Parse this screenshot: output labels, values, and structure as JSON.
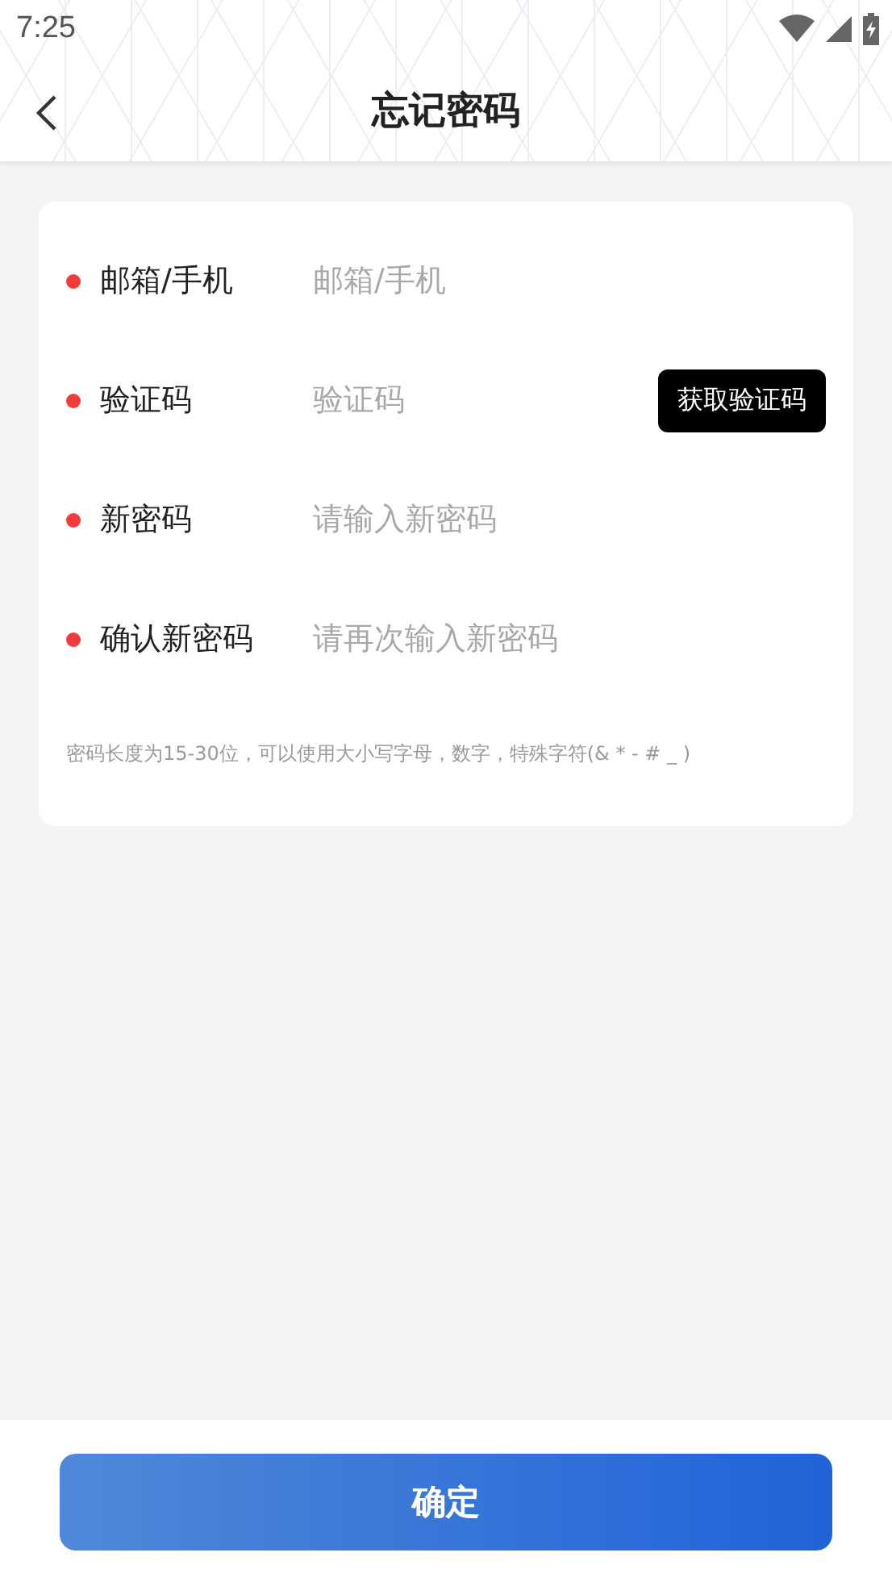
{
  "status_bar": {
    "time": "7:25"
  },
  "header": {
    "title": "忘记密码"
  },
  "fields": [
    {
      "kind": "text",
      "label": "邮箱/手机",
      "placeholder": "邮箱/手机",
      "required": true
    },
    {
      "kind": "code",
      "label": "验证码",
      "placeholder": "验证码",
      "required": true,
      "button": "获取验证码"
    },
    {
      "kind": "text",
      "label": "新密码",
      "placeholder": "请输入新密码",
      "required": true
    },
    {
      "kind": "text",
      "label": "确认新密码",
      "placeholder": "请再次输入新密码",
      "required": true
    }
  ],
  "hint": "密码长度为15-30位，可以使用大小写字母，数字，特殊字符(& * - # _ )",
  "submit_button": "确定"
}
